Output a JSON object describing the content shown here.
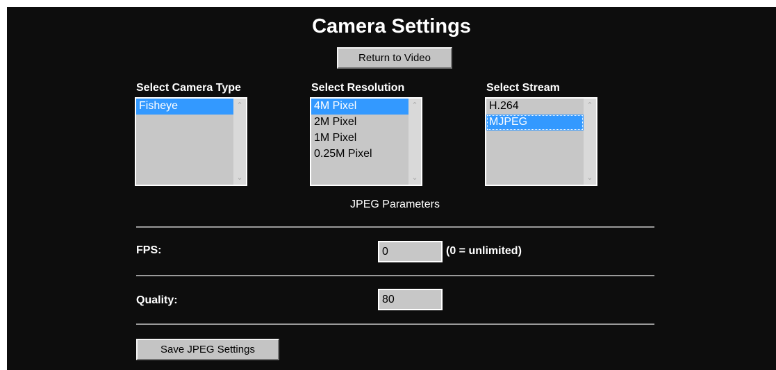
{
  "title": "Camera Settings",
  "return_button": "Return to Video",
  "camera_type": {
    "label": "Select Camera Type",
    "options": [
      "Fisheye"
    ],
    "selected": "Fisheye"
  },
  "resolution": {
    "label": "Select Resolution",
    "options": [
      "4M Pixel",
      "2M Pixel",
      "1M Pixel",
      "0.25M Pixel"
    ],
    "selected": "4M Pixel"
  },
  "stream": {
    "label": "Select Stream",
    "options": [
      "H.264",
      "MJPEG"
    ],
    "selected": "MJPEG"
  },
  "jpeg_params_heading": "JPEG Parameters",
  "fps": {
    "label": "FPS:",
    "value": "0",
    "hint": "(0 = unlimited)"
  },
  "quality": {
    "label": "Quality:",
    "value": "80"
  },
  "save_button": "Save JPEG Settings",
  "colors": {
    "background": "#0d0d0d",
    "selection": "#3399ff",
    "control": "#c7c7c7"
  }
}
